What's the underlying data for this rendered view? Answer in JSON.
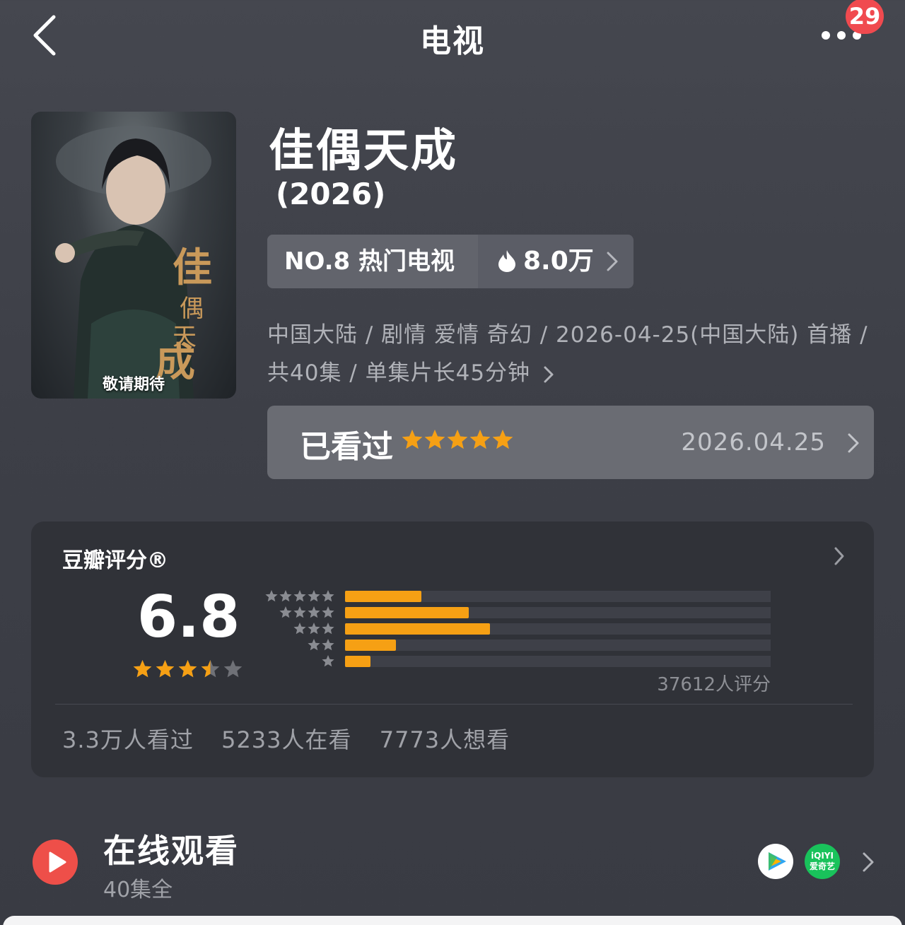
{
  "header": {
    "title": "电视",
    "notification_count": "29",
    "icons": {
      "back": "chevron-left-icon",
      "more": "more-dots-icon"
    }
  },
  "poster": {
    "caption": "敬请期待",
    "artwork_title": "佳偶天成"
  },
  "show": {
    "title": "佳偶天成",
    "year": "(2026)",
    "rank_label": "NO.8 热门电视",
    "hot_count": "8.0万",
    "meta_line_1": "中国大陆 / 剧情 爱情 奇幻 / 2026-04-25(中国大陆) 首播 /",
    "meta_line_2": "共40集 / 单集片长45分钟"
  },
  "watched": {
    "label": "已看过",
    "user_stars": 5,
    "date": "2026.04.25"
  },
  "rating": {
    "heading": "豆瓣评分®",
    "score": "6.8",
    "score_stars": 3.5,
    "rater_count": "37612人评分",
    "stats": [
      "3.3万人看过",
      "5233人在看",
      "7773人想看"
    ],
    "distribution": [
      {
        "stars": 5,
        "fraction": 0.18
      },
      {
        "stars": 4,
        "fraction": 0.29
      },
      {
        "stars": 3,
        "fraction": 0.34
      },
      {
        "stars": 2,
        "fraction": 0.12
      },
      {
        "stars": 1,
        "fraction": 0.06
      }
    ]
  },
  "online": {
    "title": "在线观看",
    "subtitle": "40集全",
    "providers": [
      {
        "name": "tencent-video",
        "icon": "tencent-video-icon"
      },
      {
        "name": "iqiyi",
        "label_top": "iQIYI",
        "label_bottom": "爱奇艺",
        "icon": "iqiyi-icon"
      }
    ]
  },
  "colors": {
    "background": "#3f4149",
    "card": "#303238",
    "accent_orange": "#f6a014",
    "play_red": "#ee4f49",
    "badge_red": "#f04a4f"
  }
}
